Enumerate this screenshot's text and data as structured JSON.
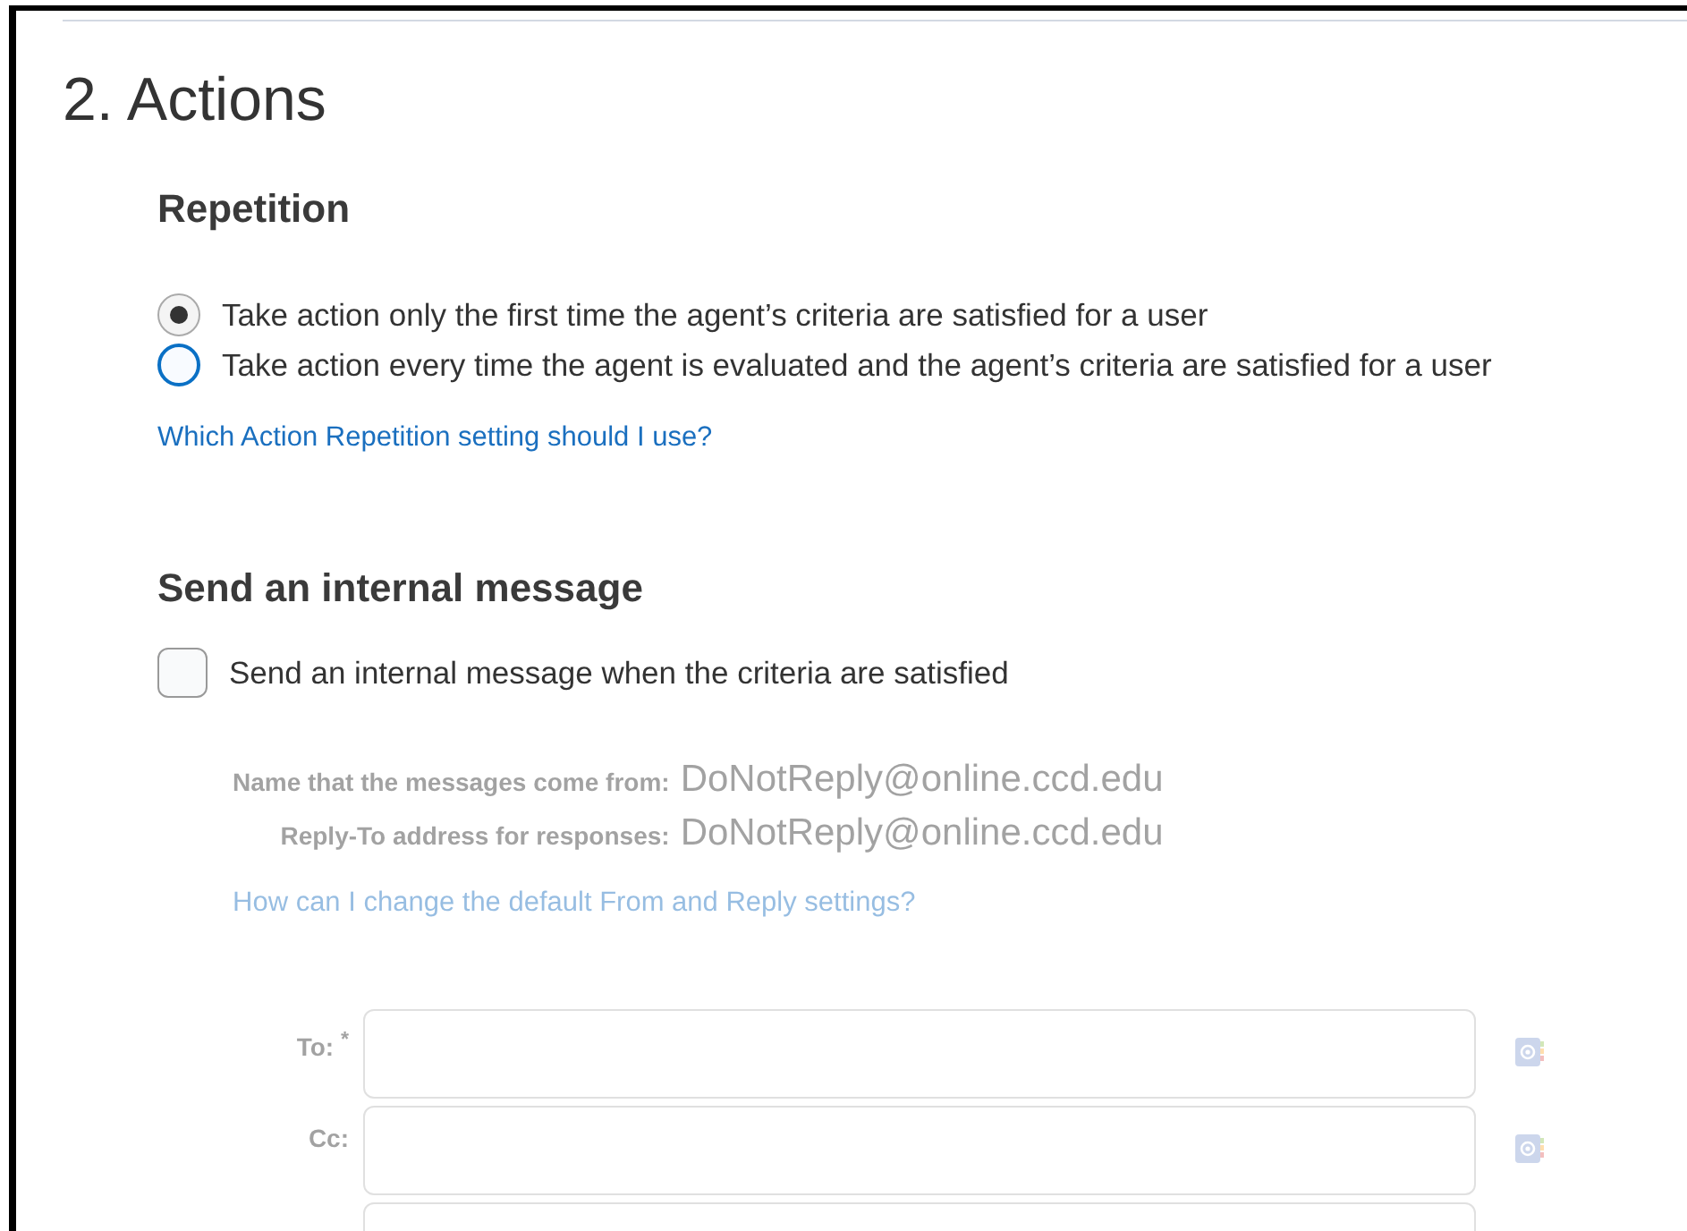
{
  "section": {
    "title": "2. Actions"
  },
  "repetition": {
    "heading": "Repetition",
    "options": [
      {
        "label": "Take action only the first time the agent’s criteria are satisfied for a user",
        "selected": true
      },
      {
        "label": "Take action every time the agent is evaluated and the agent’s criteria are satisfied for a user",
        "selected": false
      }
    ],
    "help_link": "Which Action Repetition setting should I use?"
  },
  "message": {
    "heading": "Send an internal message",
    "checkbox": {
      "label": "Send an internal message when the criteria are satisfied",
      "checked": false
    },
    "info": [
      {
        "label": "Name that the messages come from:",
        "value": "DoNotReply@online.ccd.edu"
      },
      {
        "label": "Reply-To address for responses:",
        "value": "DoNotReply@online.ccd.edu"
      }
    ],
    "help_link": "How can I change the default From and Reply settings?",
    "fields": [
      {
        "label": "To: $^{*}$",
        "address_book": true
      },
      {
        "label": "Cc:",
        "address_book": true
      },
      {
        "address_book": false
      }
    ]
  }
}
